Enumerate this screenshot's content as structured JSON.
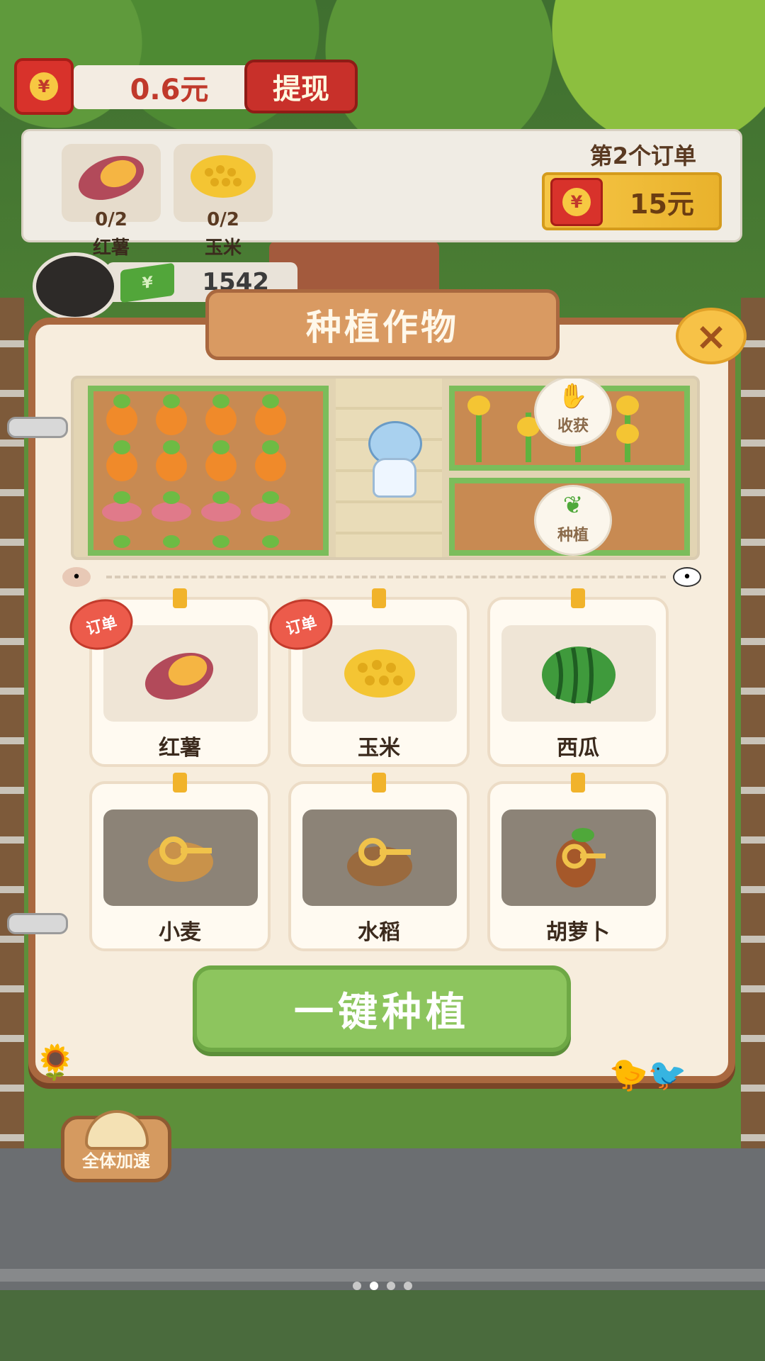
{
  "wallet": {
    "balance": "0.6元",
    "withdraw_label": "提现",
    "currency_symbol": "¥"
  },
  "order": {
    "title": "第2个订单",
    "items": [
      {
        "name": "红薯",
        "progress": "0/2",
        "icon": "sweet-potato-icon"
      },
      {
        "name": "玉米",
        "progress": "0/2",
        "icon": "corn-icon"
      }
    ],
    "reward": "15元"
  },
  "player": {
    "cash": "1542"
  },
  "modal": {
    "title": "种植作物",
    "close_label": "×",
    "farm": {
      "harvest_label": "收获",
      "plant_label": "种植"
    },
    "badge_label": "订单",
    "crops": [
      {
        "name": "红薯",
        "icon": "sweet-potato-icon",
        "locked": false,
        "order": true
      },
      {
        "name": "玉米",
        "icon": "corn-icon",
        "locked": false,
        "order": true
      },
      {
        "name": "西瓜",
        "icon": "watermelon-icon",
        "locked": false,
        "order": false
      },
      {
        "name": "小麦",
        "icon": "wheat-key-icon",
        "locked": true,
        "order": false
      },
      {
        "name": "水稻",
        "icon": "rice-key-icon",
        "locked": true,
        "order": false
      },
      {
        "name": "胡萝卜",
        "icon": "carrot-key-icon",
        "locked": true,
        "order": false
      }
    ],
    "plant_all_label": "一键种植"
  },
  "bottom": {
    "speed_label": "全体加速",
    "page_dots": 4,
    "active_dot": 2
  },
  "colors": {
    "accent_red": "#d8322b",
    "modal_brown": "#a9683f",
    "button_green": "#8dc55e"
  }
}
